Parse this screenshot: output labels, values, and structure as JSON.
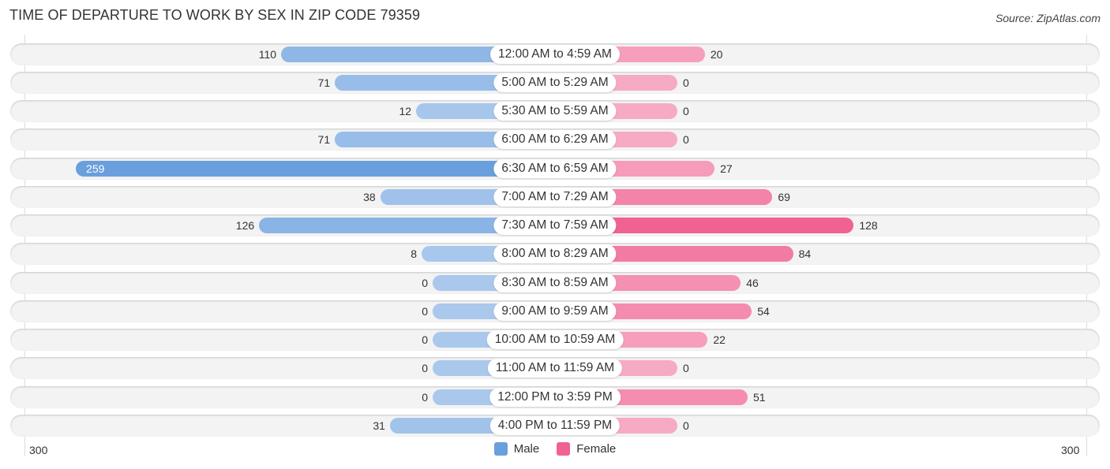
{
  "title": "TIME OF DEPARTURE TO WORK BY SEX IN ZIP CODE 79359",
  "source": "Source: ZipAtlas.com",
  "chart_data": {
    "type": "bar",
    "orientation": "horizontal-diverging",
    "title": "TIME OF DEPARTURE TO WORK BY SEX IN ZIP CODE 79359",
    "categories": [
      "12:00 AM to 4:59 AM",
      "5:00 AM to 5:29 AM",
      "5:30 AM to 5:59 AM",
      "6:00 AM to 6:29 AM",
      "6:30 AM to 6:59 AM",
      "7:00 AM to 7:29 AM",
      "7:30 AM to 7:59 AM",
      "8:00 AM to 8:29 AM",
      "8:30 AM to 8:59 AM",
      "9:00 AM to 9:59 AM",
      "10:00 AM to 10:59 AM",
      "11:00 AM to 11:59 AM",
      "12:00 PM to 3:59 PM",
      "4:00 PM to 11:59 PM"
    ],
    "series": [
      {
        "name": "Male",
        "color": "#6a9fde",
        "values": [
          110,
          71,
          12,
          71,
          259,
          38,
          126,
          8,
          0,
          0,
          0,
          0,
          0,
          31
        ]
      },
      {
        "name": "Female",
        "color": "#f06292",
        "values": [
          20,
          0,
          0,
          0,
          27,
          69,
          128,
          84,
          46,
          54,
          22,
          0,
          51,
          0
        ]
      }
    ],
    "axis": {
      "left_label": "300",
      "right_label": "300",
      "range": [
        0,
        300
      ]
    },
    "legend": {
      "position": "bottom-center",
      "items": [
        "Male",
        "Female"
      ]
    }
  }
}
